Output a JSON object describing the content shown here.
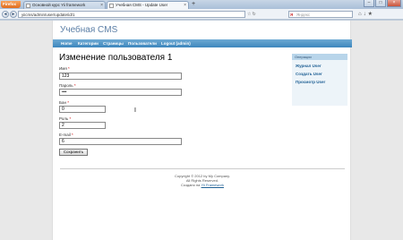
{
  "browser": {
    "app_button": "Firefox",
    "tabs": [
      {
        "label": "Основной курс Yii framework",
        "active": false
      },
      {
        "label": "Учебная CMS - Update User",
        "active": true
      }
    ],
    "new_tab": "+",
    "url": "yiicms/admin/user/update/id/1",
    "search_placeholder": "Яндекс"
  },
  "site": {
    "title": "Учебная CMS",
    "menu": [
      "Home",
      "Категории",
      "Страницы",
      "Пользователи",
      "Logout (admin)"
    ]
  },
  "form": {
    "heading": "Изменение пользователя 1",
    "fields": [
      {
        "label": "Имя",
        "required": "*",
        "value": "123"
      },
      {
        "label": "Пароль",
        "required": "*",
        "value": "•••"
      },
      {
        "label": "Бан",
        "required": "*",
        "value": "0"
      },
      {
        "label": "Роль",
        "required": "*",
        "value": "2"
      },
      {
        "label": "E-mail",
        "required": "*",
        "value": "6"
      }
    ],
    "submit": "Сохранить"
  },
  "sidebar": {
    "title": "Операции",
    "links": [
      "Журнал User",
      "Создать User",
      "Просмотр User"
    ]
  },
  "footer": {
    "line1": "Copyright © 2012 by My Company.",
    "line2": "All Rights Reserved.",
    "line3_prefix": "Создано на",
    "line3_link": "Yii Framework"
  }
}
